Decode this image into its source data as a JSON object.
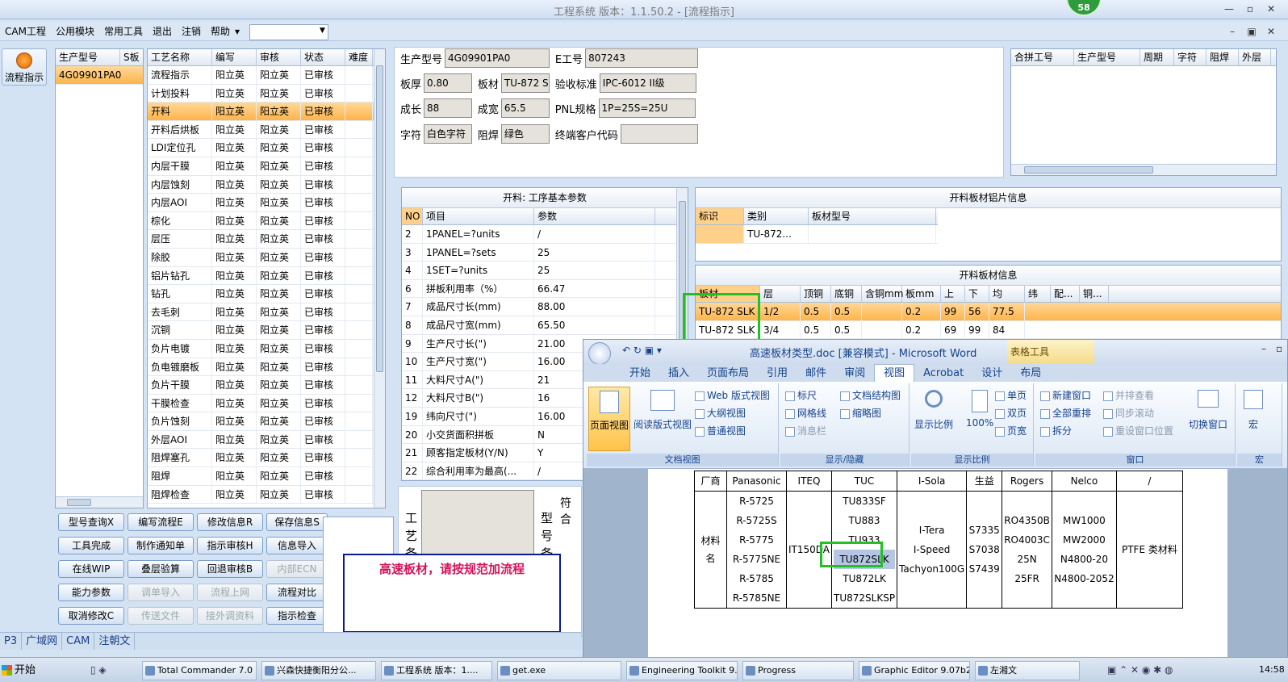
{
  "app": {
    "title": "工程系统  版本：1.1.50.2 - [流程指示]",
    "badge": "58"
  },
  "menu": [
    "CAM工程",
    "公用模块",
    "常用工具",
    "退出",
    "注销",
    "帮助"
  ],
  "left_button": "流程指示",
  "model_list": {
    "headers": [
      "生产型号",
      "S板"
    ],
    "rows": [
      "4G09901PA0"
    ]
  },
  "process_grid": {
    "headers": [
      "工艺名称",
      "编写",
      "审核",
      "状态",
      "难度"
    ],
    "rows": [
      [
        "流程指示",
        "阳立英",
        "阳立英",
        "已审核"
      ],
      [
        "计划投料",
        "阳立英",
        "阳立英",
        "已审核"
      ],
      [
        "开料",
        "阳立英",
        "阳立英",
        "已审核"
      ],
      [
        "开料后烘板",
        "阳立英",
        "阳立英",
        "已审核"
      ],
      [
        "LDI定位孔",
        "阳立英",
        "阳立英",
        "已审核"
      ],
      [
        "内层干膜",
        "阳立英",
        "阳立英",
        "已审核"
      ],
      [
        "内层蚀刻",
        "阳立英",
        "阳立英",
        "已审核"
      ],
      [
        "内层AOI",
        "阳立英",
        "阳立英",
        "已审核"
      ],
      [
        "棕化",
        "阳立英",
        "阳立英",
        "已审核"
      ],
      [
        "层压",
        "阳立英",
        "阳立英",
        "已审核"
      ],
      [
        "除胶",
        "阳立英",
        "阳立英",
        "已审核"
      ],
      [
        "铝片钻孔",
        "阳立英",
        "阳立英",
        "已审核"
      ],
      [
        "钻孔",
        "阳立英",
        "阳立英",
        "已审核"
      ],
      [
        "去毛刺",
        "阳立英",
        "阳立英",
        "已审核"
      ],
      [
        "沉铜",
        "阳立英",
        "阳立英",
        "已审核"
      ],
      [
        "负片电镀",
        "阳立英",
        "阳立英",
        "已审核"
      ],
      [
        "负电镀磨板",
        "阳立英",
        "阳立英",
        "已审核"
      ],
      [
        "负片干膜",
        "阳立英",
        "阳立英",
        "已审核"
      ],
      [
        "干膜检查",
        "阳立英",
        "阳立英",
        "已审核"
      ],
      [
        "负片蚀刻",
        "阳立英",
        "阳立英",
        "已审核"
      ],
      [
        "外层AOI",
        "阳立英",
        "阳立英",
        "已审核"
      ],
      [
        "阻焊塞孔",
        "阳立英",
        "阳立英",
        "已审核"
      ],
      [
        "阻焊",
        "阳立英",
        "阳立英",
        "已审核"
      ],
      [
        "阻焊检查",
        "阳立英",
        "阳立英",
        "已审核"
      ]
    ]
  },
  "info": {
    "prod_model_lbl": "生产型号",
    "prod_model": "4G09901PA0",
    "e_no_lbl": "E工号",
    "e_no": "807243",
    "thick_lbl": "板厚",
    "thick": "0.80",
    "mat_lbl": "板材",
    "mat": "TU-872 S",
    "std_lbl": "验收标准",
    "std": "IPC-6012 II级",
    "len_lbl": "成长",
    "len": "88",
    "wid_lbl": "成宽",
    "wid": "65.5",
    "pnl_lbl": "PNL规格",
    "pnl": "1P=25S=25U",
    "char_lbl": "字符",
    "char": "白色字符",
    "mask_lbl": "阻焊",
    "mask": "绿色",
    "cust_lbl": "终端客户代码",
    "cust": ""
  },
  "merge_grid": {
    "headers": [
      "合拼工号",
      "生产型号",
      "周期",
      "字符",
      "阻焊",
      "外层"
    ]
  },
  "params": {
    "title": "开料: 工序基本参数",
    "headers": [
      "NO",
      "项目",
      "参数"
    ],
    "rows": [
      [
        "2",
        "1PANEL=?units",
        "/"
      ],
      [
        "3",
        "1PANEL=?sets",
        "25"
      ],
      [
        "4",
        "1SET=?units",
        "25"
      ],
      [
        "6",
        "拼板利用率（%）",
        "66.47"
      ],
      [
        "7",
        "成品尺寸长(mm)",
        "88.00"
      ],
      [
        "8",
        "成品尺寸宽(mm)",
        "65.50"
      ],
      [
        "9",
        "生产尺寸长(\")",
        "21.00"
      ],
      [
        "10",
        "生产尺寸宽(\")",
        "16.00"
      ],
      [
        "11",
        "大料尺寸A(\")",
        "21"
      ],
      [
        "12",
        "大料尺寸B(\")",
        "16"
      ],
      [
        "19",
        "纬向尺寸(\")",
        "16.00"
      ],
      [
        "20",
        "小交货面积拼板",
        "N"
      ],
      [
        "21",
        "顾客指定板材(Y/N)",
        "Y"
      ],
      [
        "22",
        "综合利用率为最高(...",
        "/"
      ]
    ]
  },
  "alum": {
    "title": "开料板材铝片信息",
    "headers": [
      "标识",
      "类别",
      "板材型号"
    ],
    "row": [
      "",
      "TU-872...",
      ""
    ]
  },
  "board": {
    "title": "开料板材信息",
    "headers": [
      "板材",
      "层",
      "顶铜",
      "底铜",
      "含铜mm",
      "板mm",
      "上",
      "下",
      "均",
      "纬",
      "配...",
      "铜..."
    ],
    "rows": [
      [
        "TU-872 SLK",
        "1/2",
        "0.5",
        "0.5",
        "",
        "0.2",
        "99",
        "56",
        "77.5"
      ],
      [
        "TU-872 SLK",
        "3/4",
        "0.5",
        "0.5",
        "",
        "0.2",
        "69",
        "99",
        "84"
      ]
    ]
  },
  "remark": {
    "craft": "工艺备",
    "model": "型号备",
    "merge": "符合"
  },
  "buttons": [
    [
      "型号查询X",
      "编写流程E",
      "修改信息R",
      "保存信息S"
    ],
    [
      "工具完成",
      "制作通知单",
      "指示审核H",
      "信息导入"
    ],
    [
      "在线WIP",
      "叠层验算",
      "回退审核B",
      "内部ECN"
    ],
    [
      "能力参数",
      "调单导入",
      "流程上网",
      "流程对比"
    ],
    [
      "取消修改C",
      "传送文件",
      "接外调资料",
      "指示检查"
    ]
  ],
  "disabled_buttons": [
    "内部ECN",
    "调单导入",
    "流程上网",
    "传送文件",
    "接外调资料"
  ],
  "notice": "高速板材，请按规范加流程",
  "status": [
    "P3",
    "广域网",
    "CAM",
    "注朝文"
  ],
  "word": {
    "title": "高速板材类型.doc [兼容模式] - Microsoft Word",
    "table_tools": "表格工具",
    "tabs": [
      "开始",
      "插入",
      "页面布局",
      "引用",
      "邮件",
      "审阅",
      "视图",
      "Acrobat",
      "设计",
      "布局"
    ],
    "groups": [
      {
        "label": "文档视图",
        "items": [
          "页面视图",
          "阅读版式视图",
          "Web 版式视图",
          "大纲视图",
          "普通视图"
        ]
      },
      {
        "label": "显示/隐藏",
        "items": [
          "标尺",
          "网格线",
          "消息栏",
          "文档结构图",
          "缩略图"
        ]
      },
      {
        "label": "显示比例",
        "items": [
          "显示比例",
          "100%",
          "单页",
          "双页",
          "页宽"
        ]
      },
      {
        "label": "窗口",
        "items": [
          "新建窗口",
          "全部重排",
          "拆分",
          "并排查看",
          "同步滚动",
          "重设窗口位置",
          "切换窗口"
        ]
      },
      {
        "label": "宏",
        "items": [
          "宏"
        ]
      }
    ],
    "table": {
      "head": [
        "厂商",
        "Panasonic",
        "ITEQ",
        "TUC",
        "I-Sola",
        "生益",
        "Rogers",
        "Nelco",
        "/"
      ],
      "label": "材料名",
      "col1": [
        "R-5725",
        "R-5725S",
        "R-5775",
        "R-5775NE",
        "R-5785",
        "R-5785NE"
      ],
      "col2": "IT150DA",
      "col3": [
        "TU833SF",
        "TU883",
        "TU933",
        "TU872SLK",
        "TU872LK",
        "TU872SLKSP"
      ],
      "col4": [
        "I-Tera",
        "I-Speed",
        "Tachyon100G"
      ],
      "col5": [
        "S7335",
        "S7038",
        "S7439"
      ],
      "col6": [
        "RO4350B",
        "RO4003C",
        "25N",
        "25FR"
      ],
      "col7": [
        "MW1000",
        "MW2000",
        "N4800-20",
        "N4800-2052"
      ],
      "col8": "PTFE 类材料"
    }
  },
  "taskbar": {
    "start": "开始",
    "tasks": [
      "Total Commander 7.0 ...",
      "兴森快捷衡阳分公...",
      "工程系统  版本：1....",
      "get.exe",
      "Engineering Toolkit 9....",
      "Progress",
      "Graphic Editor 9.07b2 ...",
      "左湘文"
    ],
    "clock": "14:58"
  }
}
